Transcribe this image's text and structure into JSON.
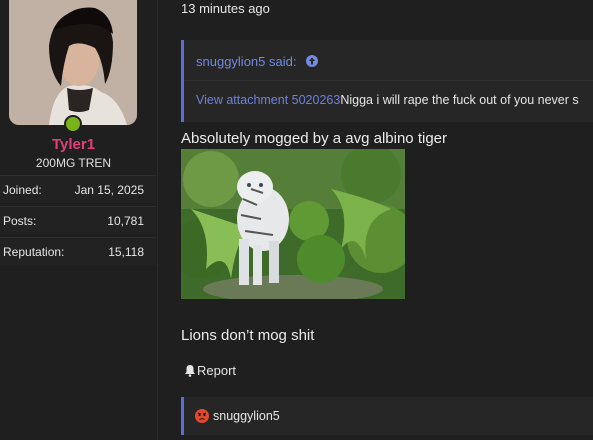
{
  "user": {
    "name": "Tyler1",
    "title": "200MG TREN",
    "stats": [
      {
        "label": "Joined:",
        "value": "Jan 15, 2025"
      },
      {
        "label": "Posts:",
        "value": "10,781"
      },
      {
        "label": "Reputation:",
        "value": "15,118"
      }
    ]
  },
  "post": {
    "timestamp": "13 minutes ago",
    "quote": {
      "author_said": "snuggylion5 said:",
      "attachment_link": "View attachment 5020263",
      "text": "Nigga i will rape the fuck out of you never s"
    },
    "line1": "Absolutely mogged by a avg albino tiger",
    "line2": "Lions don’t mog shit",
    "report_label": "Report",
    "reaction_user": "snuggylion5"
  },
  "icons": {
    "quote_up": "arrow-up-circle-icon",
    "report": "bell-icon",
    "reaction": "angry-face-icon"
  },
  "colors": {
    "username": "#e0407a",
    "link": "#6f82d8",
    "online": "#7ab317",
    "quote_border": "#5b6fd6"
  }
}
